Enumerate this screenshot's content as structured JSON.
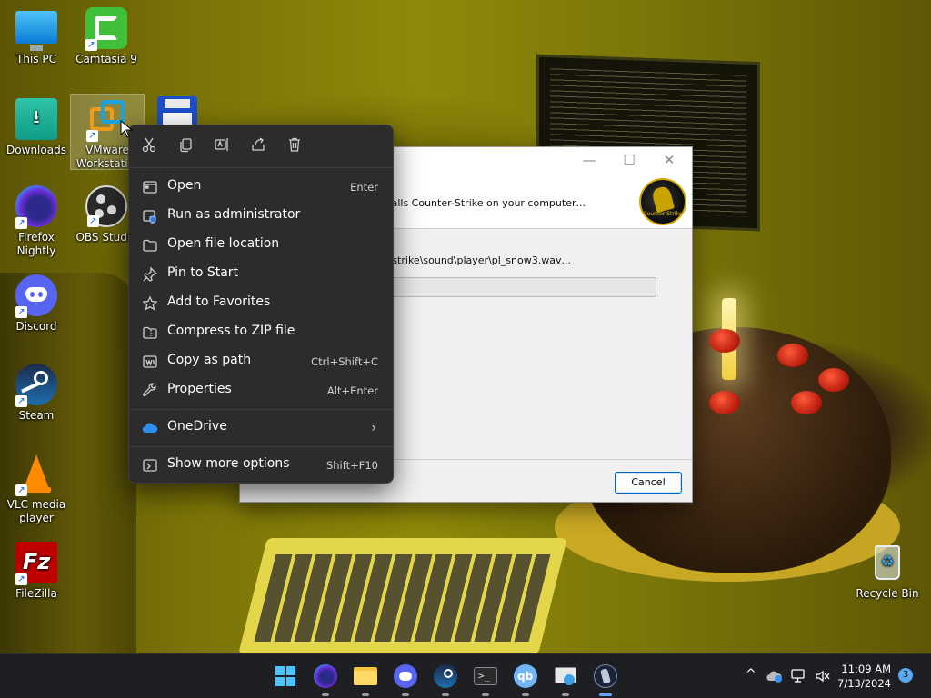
{
  "desktop": {
    "icons": [
      {
        "label": "This PC"
      },
      {
        "label": "Camtasia 9"
      },
      {
        "label": "Downloads"
      },
      {
        "label": "VMware Workstati..."
      },
      {
        "label": "Firefox Nightly"
      },
      {
        "label": "OBS Studio"
      },
      {
        "label": "Discord"
      },
      {
        "label": "Steam"
      },
      {
        "label": "VLC media player"
      },
      {
        "label": "FileZilla"
      },
      {
        "label": "Recycle Bin"
      }
    ]
  },
  "installer": {
    "header_text": "...Installs Counter-Strike on your computer.",
    "status_text": "...cstrike\\sound\\player\\pl_snow3.wav",
    "progress": 0.35,
    "cancel_label": "Cancel",
    "logo_text": "Counter-Strike"
  },
  "context_menu": {
    "quick_actions": [
      "cut",
      "copy",
      "rename",
      "share",
      "delete"
    ],
    "items": [
      {
        "label": "Open",
        "shortcut": "Enter"
      },
      {
        "label": "Run as administrator",
        "shortcut": ""
      },
      {
        "label": "Open file location",
        "shortcut": ""
      },
      {
        "label": "Pin to Start",
        "shortcut": ""
      },
      {
        "label": "Add to Favorites",
        "shortcut": ""
      },
      {
        "label": "Compress to ZIP file",
        "shortcut": ""
      },
      {
        "label": "Copy as path",
        "shortcut": "Ctrl+Shift+C"
      },
      {
        "label": "Properties",
        "shortcut": "Alt+Enter"
      },
      {
        "label": "OneDrive",
        "shortcut": ""
      },
      {
        "label": "Show more options",
        "shortcut": "Shift+F10"
      }
    ]
  },
  "taskbar": {
    "clock_time": "11:09 AM",
    "clock_date": "7/13/2024",
    "notification_count": "3"
  },
  "colors": {
    "menu_bg": "#2c2c2c",
    "progress_green": "#06b025",
    "accent_blue": "#0067c0",
    "taskbar_bg": "#1e1f22"
  }
}
